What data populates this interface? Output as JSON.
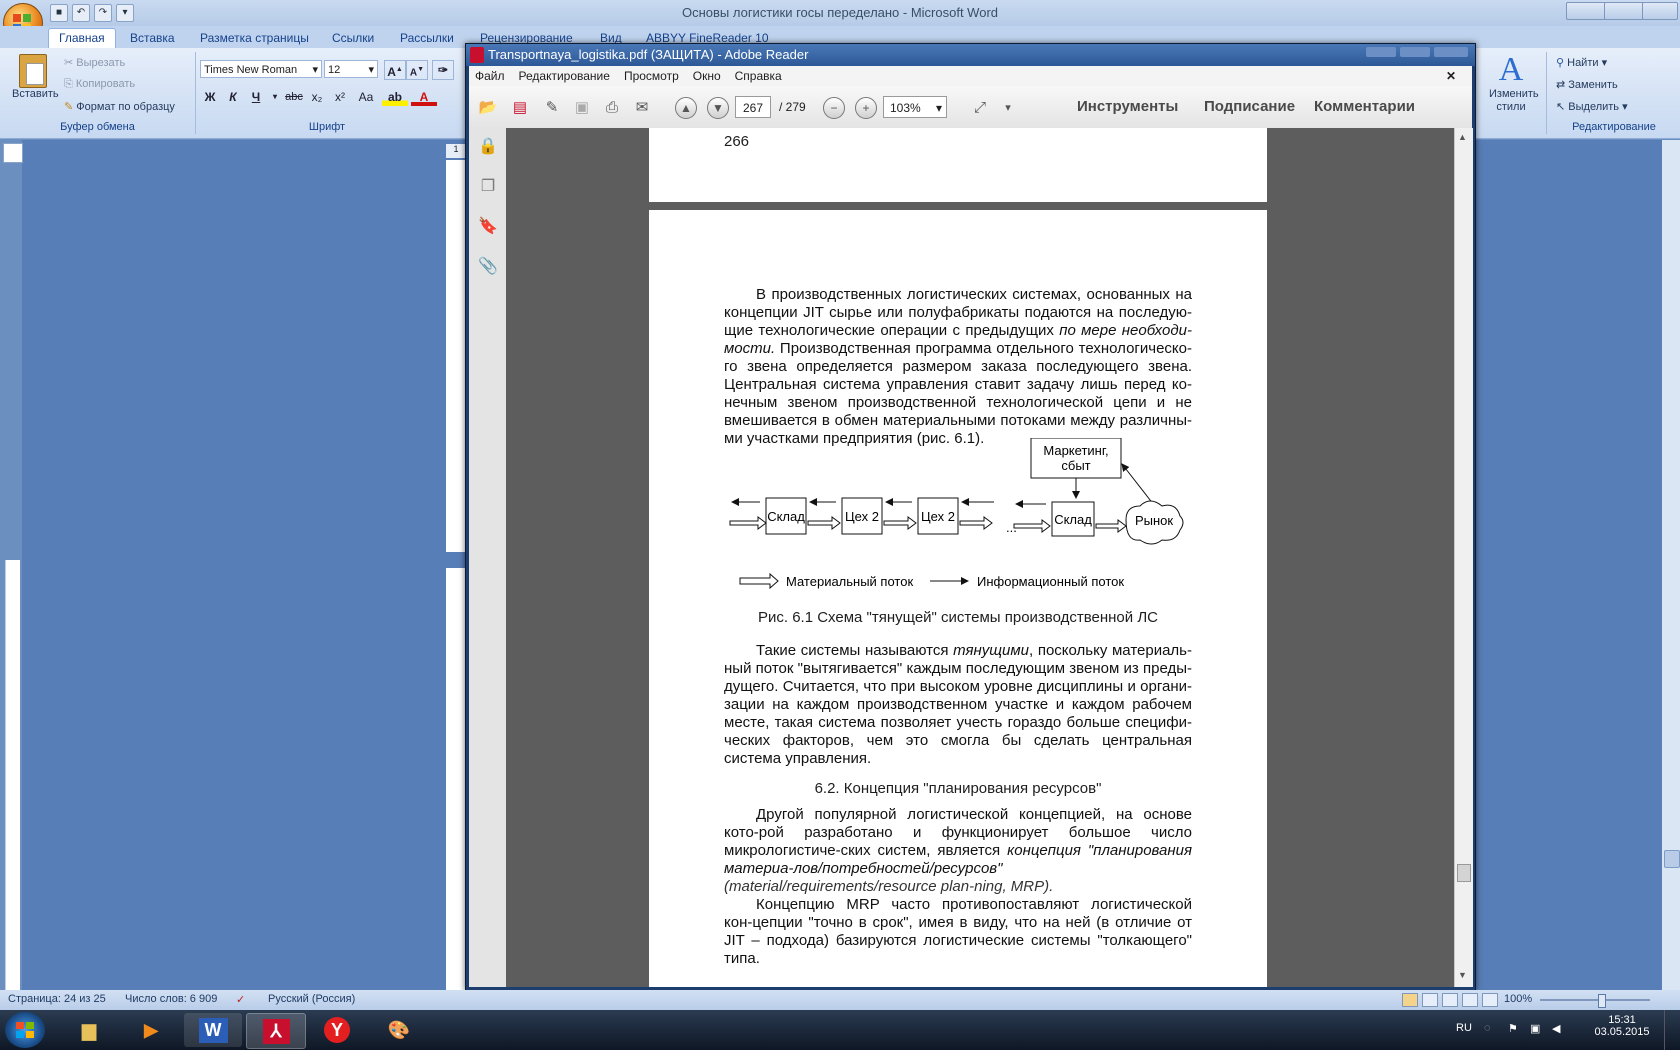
{
  "word": {
    "title": "Основы логистики госы переделано - Microsoft Word",
    "tabs": [
      "Главная",
      "Вставка",
      "Разметка страницы",
      "Ссылки",
      "Рассылки",
      "Рецензирование",
      "Вид",
      "ABBYY FineReader 10"
    ],
    "clipboard": {
      "paste": "Вставить",
      "cut": "Вырезать",
      "copy": "Копировать",
      "format_painter": "Формат по образцу",
      "label": "Буфер обмена"
    },
    "font": {
      "name": "Times New Roman",
      "size": "12",
      "label": "Шрифт",
      "buttons": [
        "Ж",
        "К",
        "Ч",
        "abc",
        "x₂",
        "x²",
        "Aa"
      ]
    },
    "styles": {
      "change": "Изменить стили"
    },
    "editing": {
      "find": "Найти",
      "replace": "Заменить",
      "select": "Выделить",
      "label": "Редактирование"
    },
    "ruler_number": "1",
    "status": {
      "page": "Страница: 24 из 25",
      "words": "Число слов: 6 909",
      "lang": "Русский (Россия)",
      "zoom": "100%"
    }
  },
  "reader": {
    "title": "Transportnaya_logistika.pdf (ЗАЩИТА) - Adobe Reader",
    "menu": [
      "Файл",
      "Редактирование",
      "Просмотр",
      "Окно",
      "Справка"
    ],
    "page_current": "267",
    "page_total": "/ 279",
    "zoom": "103%",
    "links": [
      "Инструменты",
      "Подписание",
      "Комментарии"
    ],
    "page_number_prev": "266",
    "para1_a": "В производственных логистических системах, основанных на концепции JIT сырье или полуфабрикаты подаются на последую-щие технологические операции с предыдущих ",
    "para1_em": "по мере необходи-мости.",
    "para1_b": " Производственная программа отдельного технологическо-го звена определяется размером заказа последующего звена. Центральная система управления ставит задачу лишь перед ко-нечным звеном производственной технологической цепи и не вмешивается в обмен материальными потоками между различны-ми участками предприятия (рис. 6.1).",
    "diagram": {
      "marketing": "Маркетинг,",
      "marketing2": "сбыт",
      "warehouse": "Склад",
      "shop": "Цех 2",
      "dots": "...",
      "market": "Рынок",
      "legend_material": "Материальный поток",
      "legend_info": "Информационный поток"
    },
    "caption": "Рис. 6.1 Схема \"тянущей\" системы производственной ЛС",
    "para2_a": "Такие системы называются ",
    "para2_em": "тянущими",
    "para2_b": ", поскольку материаль-ный поток \"вытягивается\" каждым последующим звеном из преды-дущего. Считается, что при высоком уровне дисциплины и органи-зации на каждом производственном участке и каждом рабочем месте, такая система позволяет учесть гораздо больше специфи-ческих факторов, чем это смогла бы сделать центральная система управления.",
    "heading": "6.2. Концепция \"планирования ресурсов\"",
    "para3_a": "Другой популярной логистической концепцией, на основе кото-рой разработано и функционирует большое число микрологистиче-ских систем, является ",
    "para3_em": "концепция \"планирования материа-лов/потребностей/ресурсов\"",
    "para3_b": " (material/requirements/resource plan-ning, MRP).",
    "para4": "Концепцию MRP часто противопоставляют логистической кон-цепции \"точно в срок\", имея в виду, что на ней (в отличие от JIT – подхода) базируются логистические системы \"толкающего\" типа."
  },
  "taskbar": {
    "lang": "RU",
    "time": "15:31",
    "date": "03.05.2015"
  },
  "colors": {
    "word_blue": "#587eb8",
    "reader_gray": "#5d5d5d",
    "acrobat_red": "#c8102e",
    "yandex_red": "#e41f1f"
  }
}
